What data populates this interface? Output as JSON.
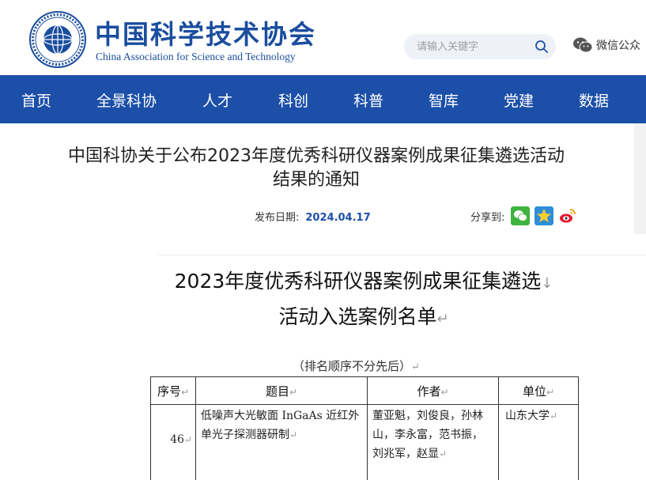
{
  "header": {
    "logo_cn": "中国科学技术协会",
    "logo_en": "China Association for Science and Technology",
    "search_placeholder": "请输入关键字",
    "wechat_label": "微信公众"
  },
  "nav": {
    "items": [
      "首页",
      "全景科协",
      "人才",
      "科创",
      "科普",
      "智库",
      "党建",
      "数据"
    ]
  },
  "article": {
    "title_line1": "中国科协关于公布2023年度优秀科研仪器案例成果征集遴选活动",
    "title_line2": "结果的通知",
    "date_label": "发布日期:",
    "date": "2024.04.17",
    "share_label": "分享到:"
  },
  "document": {
    "title_line1": "2023年度优秀科研仪器案例成果征集遴选",
    "title_line2": "活动入选案例名单",
    "note": "（排名顺序不分先后）",
    "table": {
      "headers": [
        "序号",
        "题目",
        "作者",
        "单位"
      ],
      "rows": [
        {
          "no": "46",
          "topic": "低噪声大光敏面 InGaAs 近红外单光子探测器研制",
          "authors": "董亚魁，刘俊良，孙林山，李永富，范书振，刘兆军，赵显",
          "unit": "山东大学"
        }
      ]
    }
  },
  "colors": {
    "brand_blue": "#1c4fa8",
    "logo_blue": "#1a4d9e"
  }
}
